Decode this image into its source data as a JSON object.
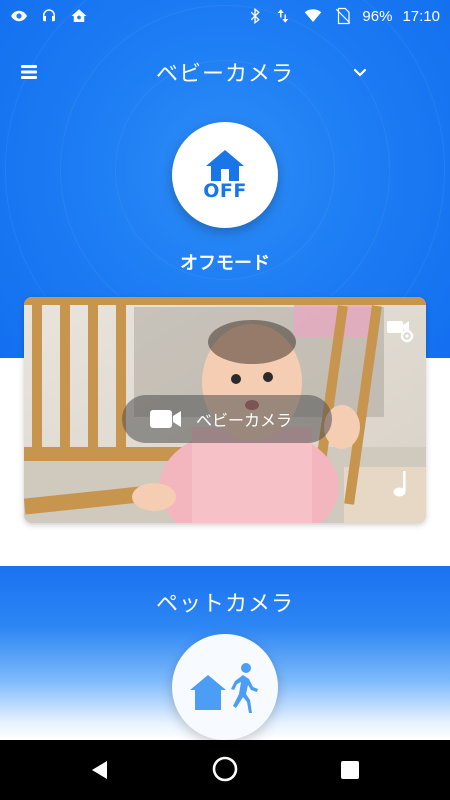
{
  "status_bar": {
    "battery": "96%",
    "time": "17:10",
    "left_icons": [
      "eye-icon",
      "headset-icon",
      "home-status-icon"
    ],
    "right_icons": [
      "bluetooth-icon",
      "data-arrows-icon",
      "wifi-icon",
      "no-sim-icon"
    ]
  },
  "app_bar": {
    "title": "ベビーカメラ",
    "menu_icon": "hamburger-menu-icon",
    "dropdown_icon": "chevron-down-icon"
  },
  "mode": {
    "icon": "home-icon",
    "badge": "OFF",
    "label": "オフモード"
  },
  "camera_card": {
    "pill_label": "ベビーカメラ",
    "pill_icon": "video-camera-icon",
    "settings_icon": "camera-settings-icon",
    "music_icon": "music-note-icon"
  },
  "pet_section": {
    "title": "ペットカメラ",
    "mode_icon": "home-away-icon"
  },
  "nav_bar": {
    "icons": [
      "back-icon",
      "home-nav-icon",
      "recent-apps-icon"
    ]
  },
  "colors": {
    "primary": "#1f7ff4",
    "accent_text": "#1976e8"
  }
}
